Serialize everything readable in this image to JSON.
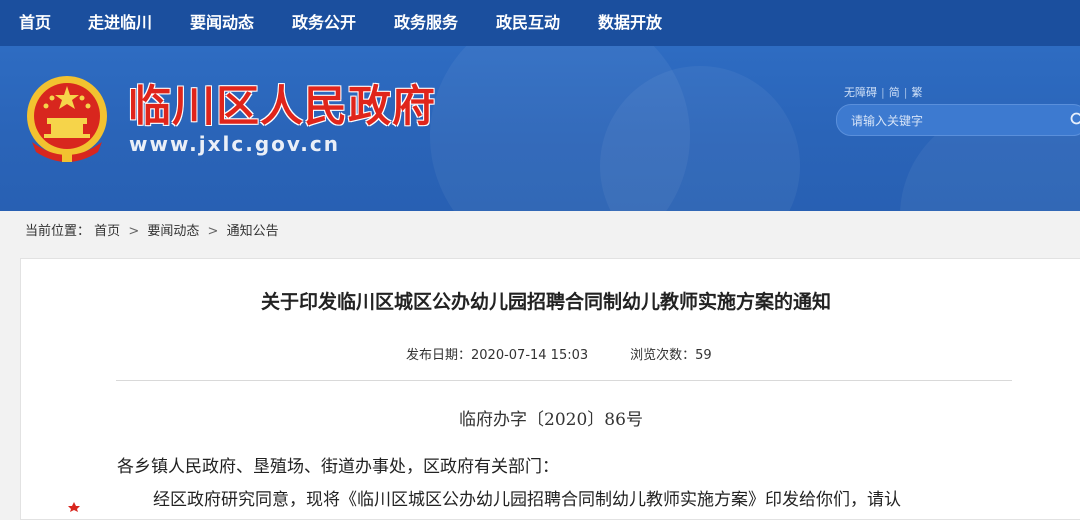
{
  "nav": {
    "items": [
      {
        "label": "首页"
      },
      {
        "label": "走进临川"
      },
      {
        "label": "要闻动态"
      },
      {
        "label": "政务公开"
      },
      {
        "label": "政务服务"
      },
      {
        "label": "政民互动"
      },
      {
        "label": "数据开放"
      }
    ]
  },
  "header": {
    "site_title": "临川区人民政府",
    "site_url": "www.jxlc.gov.cn",
    "emblem_icon": "national-emblem-icon",
    "utility": {
      "accessibility": "无障碍",
      "simplified": "简",
      "traditional": "繁"
    },
    "search": {
      "placeholder": "请输入关键字",
      "icon": "search-icon"
    }
  },
  "breadcrumb": {
    "prefix": "当前位置：",
    "items": [
      "首页",
      "要闻动态",
      "通知公告"
    ],
    "separator": ">"
  },
  "article": {
    "title": "关于印发临川区城区公办幼儿园招聘合同制幼儿教师实施方案的通知",
    "publish_date": "发布日期：2020-07-14 15:03",
    "views": "浏览次数：59",
    "doc_number": "临府办字〔2020〕86号",
    "salutation": "各乡镇人民政府、垦殖场、街道办事处，区政府有关部门：",
    "first_line": "经区政府研究同意，现将《临川区城区公办幼儿园招聘合同制幼儿教师实施方案》印发给你们，请认"
  },
  "colors": {
    "nav_bg": "#1b4f9e",
    "banner_bg": "#2a64b8",
    "title_red": "#e0251b"
  }
}
